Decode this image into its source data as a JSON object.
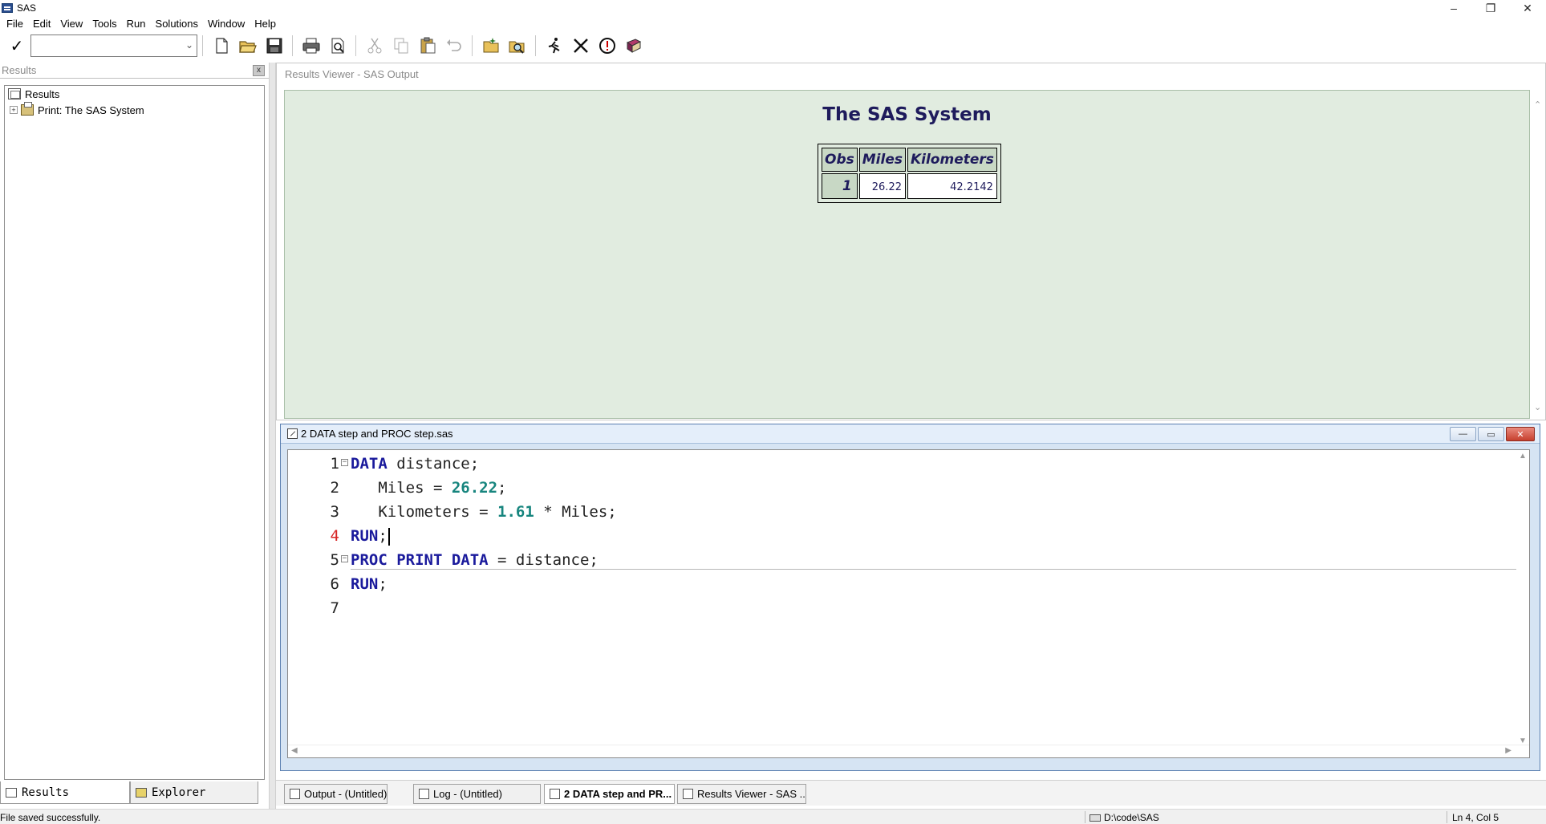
{
  "window": {
    "title": "SAS",
    "controls": {
      "minimize": "–",
      "restore": "❐",
      "close": "✕"
    }
  },
  "menu": {
    "items": [
      "File",
      "Edit",
      "View",
      "Tools",
      "Run",
      "Solutions",
      "Window",
      "Help"
    ]
  },
  "toolbar": {
    "check_symbol": "✓",
    "command_value": "",
    "buttons": [
      "new",
      "open",
      "save",
      "print",
      "print-preview",
      "cut",
      "copy",
      "paste",
      "undo",
      "new-library",
      "explorer",
      "submit",
      "clear-all",
      "break",
      "help"
    ]
  },
  "results_pane": {
    "title": "Results",
    "close_symbol": "x",
    "tree": {
      "root_label": "Results",
      "child_expander": "+",
      "child_label": "Print:  The SAS System"
    },
    "tabs": [
      "Results",
      "Explorer"
    ]
  },
  "viewer": {
    "title": "Results Viewer - SAS Output",
    "report_title": "The SAS System",
    "table": {
      "headers": [
        "Obs",
        "Miles",
        "Kilometers"
      ],
      "rows": [
        [
          "1",
          "26.22",
          "42.2142"
        ]
      ]
    }
  },
  "editor": {
    "title": "2 DATA step and PROC step.sas",
    "controls": {
      "minimize": "—",
      "restore": "▭",
      "close": "✕"
    },
    "current_line": 4,
    "lines": [
      {
        "num": "1",
        "fold": "⊟",
        "parts": [
          [
            "kw",
            "DATA"
          ],
          [
            "plain",
            " distance;"
          ]
        ]
      },
      {
        "num": "2",
        "fold": "",
        "parts": [
          [
            "plain",
            "   Miles = "
          ],
          [
            "num",
            "26.22"
          ],
          [
            "plain",
            ";"
          ]
        ]
      },
      {
        "num": "3",
        "fold": "",
        "parts": [
          [
            "plain",
            "   Kilometers = "
          ],
          [
            "num",
            "1.61"
          ],
          [
            "plain",
            " * Miles;"
          ]
        ]
      },
      {
        "num": "4",
        "fold": "",
        "parts": [
          [
            "kw",
            "RUN"
          ],
          [
            "plain",
            ";"
          ]
        ]
      },
      {
        "num": "5",
        "fold": "⊟",
        "parts": [
          [
            "kw",
            "PROC PRINT DATA"
          ],
          [
            "plain",
            " = distance;"
          ]
        ]
      },
      {
        "num": "6",
        "fold": "",
        "parts": [
          [
            "kw",
            "RUN"
          ],
          [
            "plain",
            ";"
          ]
        ]
      },
      {
        "num": "7",
        "fold": "",
        "parts": []
      }
    ]
  },
  "window_tabs": [
    {
      "label": "Output - (Untitled)",
      "active": false
    },
    {
      "label": "Log - (Untitled)",
      "active": false
    },
    {
      "label": "2 DATA step and PR...",
      "active": true
    },
    {
      "label": "Results Viewer - SAS ...",
      "active": false
    }
  ],
  "status": {
    "message": "File saved successfully.",
    "path": "D:\\code\\SAS",
    "position": "Ln 4, Col 5"
  },
  "colors": {
    "viewer_background": "#e1ece0",
    "header_cell": "#c8d8c5",
    "report_text": "#1e1b5c",
    "keyword": "#1a1a9c",
    "number": "#17857e",
    "current_line_number": "#d62424"
  }
}
